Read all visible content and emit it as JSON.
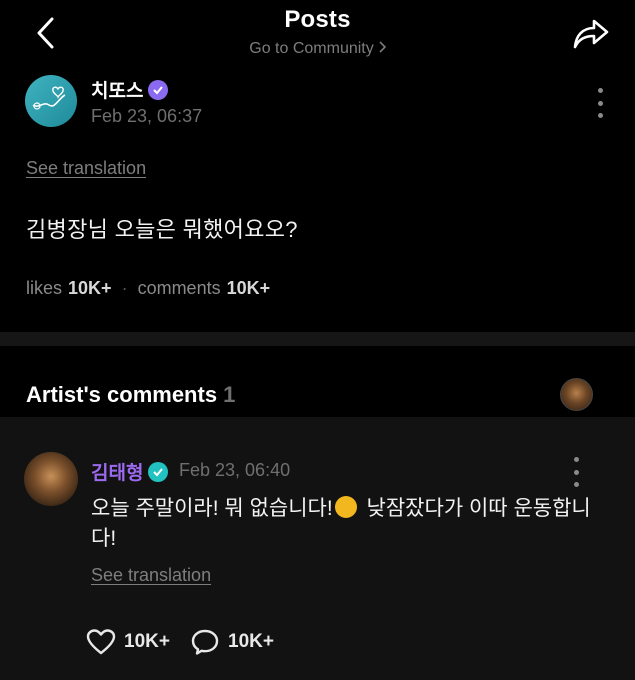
{
  "header": {
    "title": "Posts",
    "subtitle": "Go to Community",
    "back_icon": "chevron-left-icon",
    "share_icon": "share-arrow-icon"
  },
  "post": {
    "author": "치또스",
    "timestamp": "Feb 23, 06:37",
    "see_translation": "See translation",
    "body": "김병장님 오늘은 뭐했어요오?",
    "likes_label": "likes",
    "likes_count": "10K+",
    "comments_label": "comments",
    "comments_count": "10K+"
  },
  "artist_comments": {
    "title": "Artist's comments",
    "count": "1",
    "comment": {
      "author": "김태형",
      "timestamp": "Feb 23, 06:40",
      "text_before_emoji": "오늘 주말이라! 뭐 없습니다!",
      "text_after_emoji": " 낮잠잤다가 이따 운동합니다!",
      "see_translation": "See translation",
      "like_count": "10K+",
      "reply_count": "10K+"
    }
  },
  "colors": {
    "background": "#000000",
    "comment_panel": "#121212",
    "artist_name": "#9c6af0",
    "muted_text": "#7e7e7e",
    "verified_badge_post": "#8a6bf0",
    "verified_badge_comment": "#21c2c0"
  }
}
